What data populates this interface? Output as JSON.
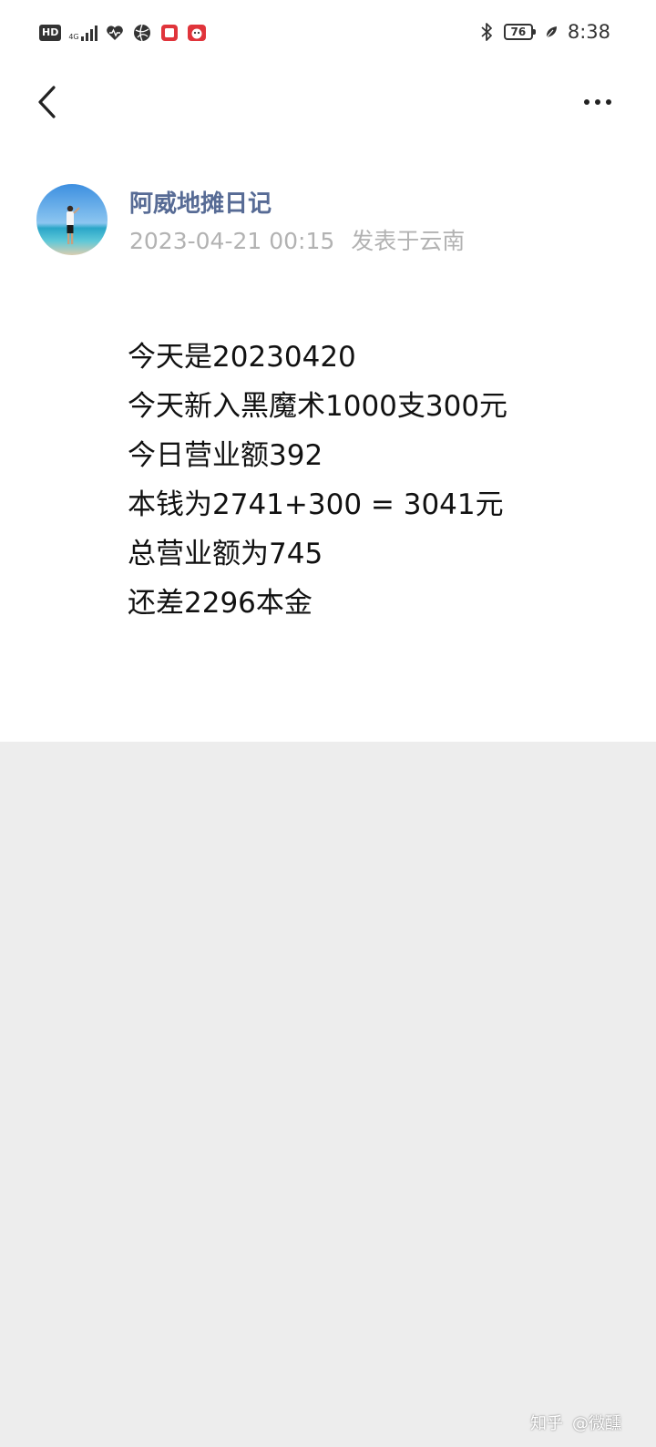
{
  "status_bar": {
    "hd": "HD",
    "network": "4G",
    "battery": "76",
    "time": "8:38",
    "icons_left": [
      "hd-badge",
      "signal-icon",
      "heart-icon",
      "globe-icon",
      "notification-icon",
      "app-icon"
    ],
    "icons_right": [
      "bluetooth-icon",
      "battery-icon",
      "leaf-icon"
    ]
  },
  "header": {
    "back_icon": "chevron-left-icon",
    "more_icon": "more-dots-icon"
  },
  "author": {
    "name": "阿威地摊日记",
    "timestamp": "2023-04-21 00:15",
    "location": "发表于云南"
  },
  "post": {
    "lines": [
      "今天是20230420",
      "今天新入黑魔术1000支300元",
      "今日营业额392",
      "本钱为2741+300 = 3041元",
      "总营业额为745",
      "还差2296本金"
    ]
  },
  "watermark": {
    "platform": "知乎",
    "handle": "@微醺"
  },
  "colors": {
    "author_name": "#576b95",
    "meta_text": "#b2b2b2",
    "body_text": "#111111",
    "page_bg": "#ffffff",
    "lower_bg": "#ededed"
  }
}
